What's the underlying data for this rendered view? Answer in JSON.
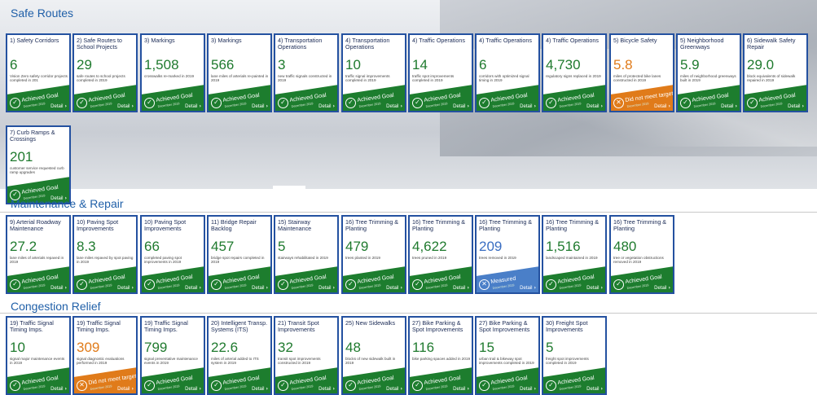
{
  "sections": [
    {
      "title": "Safe Routes",
      "cards": [
        {
          "title": "1) Safety Corridors",
          "value": "6",
          "desc": "Vision Zero safety corridor projects completed in 201",
          "status": "Achieved Goal",
          "kind": "goal"
        },
        {
          "title": "2) Safe Routes to School Projects",
          "value": "29",
          "desc": "safe routes to school projects completed in 2019",
          "status": "Achieved Goal",
          "kind": "goal"
        },
        {
          "title": "3) Markings",
          "value": "1,508",
          "desc": "crosswalks re-marked in 2019",
          "status": "Achieved Goal",
          "kind": "goal"
        },
        {
          "title": "3) Markings",
          "value": "566",
          "desc": "lane miles of arterials re-painted in 2019",
          "status": "Achieved Goal",
          "kind": "goal"
        },
        {
          "title": "4) Transportation Operations",
          "value": "3",
          "desc": "new traffic signals constructed in 2019",
          "status": "Achieved Goal",
          "kind": "goal"
        },
        {
          "title": "4) Transportation Operations",
          "value": "10",
          "desc": "traffic signal improvements completed in 2019",
          "status": "Achieved Goal",
          "kind": "goal"
        },
        {
          "title": "4) Traffic Operations",
          "value": "14",
          "desc": "traffic spot improvements completed in 2019",
          "status": "Achieved Goal",
          "kind": "goal"
        },
        {
          "title": "4) Traffic Operations",
          "value": "6",
          "desc": "corridors with optimized signal timing in 2019",
          "status": "Achieved Goal",
          "kind": "goal"
        },
        {
          "title": "4) Traffic Operations",
          "value": "4,730",
          "desc": "regulatory signs replaced in 2019",
          "status": "Achieved Goal",
          "kind": "goal"
        },
        {
          "title": "5) Bicycle Safety",
          "value": "5.8",
          "desc": "miles of protected bike lanes constructed in 2019",
          "status": "Did not meet target",
          "kind": "miss"
        },
        {
          "title": "5) Neighborhood Greenways",
          "value": "5.9",
          "desc": "miles of neighborhood greenways built in 2019",
          "status": "Achieved Goal",
          "kind": "goal"
        },
        {
          "title": "6) Sidewalk Safety Repair",
          "value": "29.0",
          "desc": "block equivalents of sidewalk repaired in 2019",
          "status": "Achieved Goal",
          "kind": "goal"
        },
        {
          "title": "7) Curb Ramps & Crossings",
          "value": "201",
          "desc": "customer service requested curb ramp upgrades",
          "status": "Achieved Goal",
          "kind": "goal"
        }
      ]
    },
    {
      "title": "Maintenance & Repair",
      "cards": [
        {
          "title": "9) Arterial Roadway Maintenance",
          "value": "27.2",
          "desc": "lane miles of arterials repaved in 2019",
          "status": "Achieved Goal",
          "kind": "goal"
        },
        {
          "title": "10) Paving Spot Improvements",
          "value": "8.3",
          "desc": "lane miles repaved by spot paving in 2019",
          "status": "Achieved Goal",
          "kind": "goal"
        },
        {
          "title": "10) Paving Spot Improvements",
          "value": "66",
          "desc": "completed paving spot improvements in 2019",
          "status": "Achieved Goal",
          "kind": "goal"
        },
        {
          "title": "11) Bridge Repair Backlog",
          "value": "457",
          "desc": "bridge spot repairs completed in 2019",
          "status": "Achieved Goal",
          "kind": "goal"
        },
        {
          "title": "15) Stairway Maintenance",
          "value": "5",
          "desc": "stairways rehabilitated in 2019",
          "status": "Achieved Goal",
          "kind": "goal"
        },
        {
          "title": "16) Tree Trimming & Planting",
          "value": "479",
          "desc": "trees planted in 2019",
          "status": "Achieved Goal",
          "kind": "goal"
        },
        {
          "title": "16) Tree Trimming & Planting",
          "value": "4,622",
          "desc": "trees pruned in 2019",
          "status": "Achieved Goal",
          "kind": "goal"
        },
        {
          "title": "16) Tree Trimming & Planting",
          "value": "209",
          "desc": "trees removed in 2019",
          "status": "Measured",
          "kind": "meas"
        },
        {
          "title": "16) Tree Trimming & Planting",
          "value": "1,516",
          "desc": "landscaped maintained in 2019",
          "status": "Achieved Goal",
          "kind": "goal"
        },
        {
          "title": "16) Tree Trimming & Planting",
          "value": "480",
          "desc": "tree or vegetation obstructions removed in 2019",
          "status": "Achieved Goal",
          "kind": "goal"
        }
      ]
    },
    {
      "title": "Congestion Relief",
      "cards": [
        {
          "title": "19) Traffic Signal Timing Imps.",
          "value": "10",
          "desc": "signal major maintenance events in 2019",
          "status": "Achieved Goal",
          "kind": "goal"
        },
        {
          "title": "19) Traffic Signal Timing Imps.",
          "value": "309",
          "desc": "signal diagnostic evaluations performed in 2019",
          "status": "Did not meet target",
          "kind": "miss"
        },
        {
          "title": "19) Traffic Signal Timing Imps.",
          "value": "799",
          "desc": "signal preventative maintenance events in 2019",
          "status": "Achieved Goal",
          "kind": "goal"
        },
        {
          "title": "20) Intelligent Transp. Systems (ITS)",
          "value": "22.6",
          "desc": "miles of arterial added to ITS system in 2019",
          "status": "Achieved Goal",
          "kind": "goal"
        },
        {
          "title": "21) Transit Spot Improvements",
          "value": "32",
          "desc": "transit spot improvements constructed in 2019",
          "status": "Achieved Goal",
          "kind": "goal"
        },
        {
          "title": "25) New Sidewalks",
          "value": "48",
          "desc": "blocks of new sidewalk built in 2019",
          "status": "Achieved Goal",
          "kind": "goal"
        },
        {
          "title": "27) Bike Parking & Spot Improvements",
          "value": "116",
          "desc": "bike parking spaces added in 2019",
          "status": "Achieved Goal",
          "kind": "goal"
        },
        {
          "title": "27) Bike Parking & Spot Improvements",
          "value": "15",
          "desc": "urban trail & bikeway spot improvements completed in 2019",
          "status": "Achieved Goal",
          "kind": "goal"
        },
        {
          "title": "30) Freight Spot Improvements",
          "value": "5",
          "desc": "freight spot improvements completed in 2019",
          "status": "Achieved Goal",
          "kind": "goal"
        }
      ]
    }
  ],
  "card_date": "December 2019",
  "detail_label": "Detail",
  "icons": {
    "goal": "check-circle-icon",
    "miss": "x-circle-icon",
    "meas": "x-circle-icon",
    "detail": "chevron-right-icon"
  },
  "colors": {
    "header": "#1f5fa8",
    "border": "#2451a0",
    "goal": "#1d7d2e",
    "miss": "#e07b1a",
    "meas": "#4a7fc8"
  }
}
